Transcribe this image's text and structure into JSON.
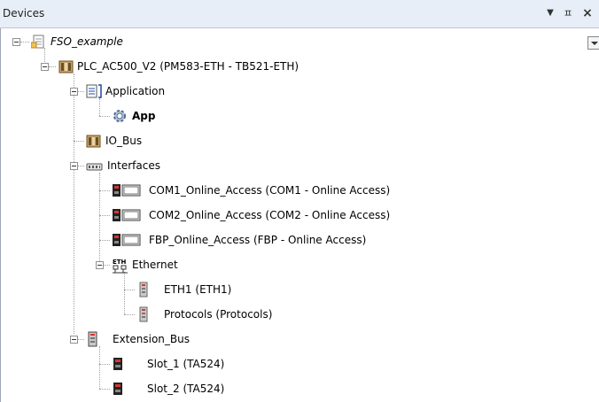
{
  "panel": {
    "title": "Devices",
    "pin_glyph": "Ԅ",
    "close_glyph": "×",
    "dropdown_glyph": "▾"
  },
  "tree": {
    "root": "FSO_example",
    "plc": "PLC_AC500_V2 (PM583-ETH - TB521-ETH)",
    "application": "Application",
    "app": "App",
    "io_bus": "IO_Bus",
    "interfaces": "Interfaces",
    "com1": "COM1_Online_Access (COM1 - Online Access)",
    "com2": "COM2_Online_Access (COM2 - Online Access)",
    "fbp": "FBP_Online_Access (FBP - Online Access)",
    "ethernet": "Ethernet",
    "eth_icon_text": "ETH",
    "eth1": "ETH1 (ETH1)",
    "protocols": "Protocols (Protocols)",
    "extension_bus": "Extension_Bus",
    "slot1": "Slot_1 (TA524)",
    "slot2": "Slot_2 (TA524)"
  }
}
